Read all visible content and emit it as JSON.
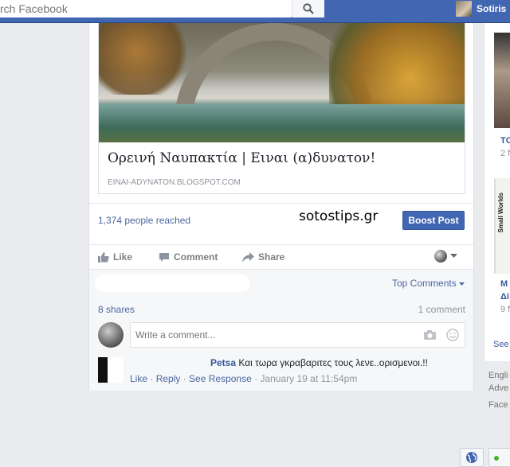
{
  "header": {
    "search_placeholder": "rch Facebook",
    "user_name": "Sotiris"
  },
  "post": {
    "link_title": "Ορεινή Ναυπακτία | Ειναι (α)δυνατον!",
    "link_domain": "EINAI-ADYNATON.BLOGSPOT.COM",
    "reach": "1,374 people reached",
    "watermark": "sotostips.gr",
    "boost_label": "Boost Post",
    "actions": {
      "like": "Like",
      "comment": "Comment",
      "share": "Share"
    },
    "top_comments": "Top Comments",
    "shares": "8 shares",
    "comment_count": "1 comment",
    "compose_placeholder": "Write a comment...",
    "comment": {
      "author": "Petsa",
      "text": "Και τωρα γκραβαριτες τους λενε..ορισμενοι.!!",
      "like": "Like",
      "reply": "Reply",
      "see_response": "See Response",
      "time": "January 19 at 11:54pm"
    }
  },
  "right": {
    "item1_title": "TC",
    "item1_sub": "2 f",
    "item2_book": "Small Worlds",
    "item2_title": "Μ",
    "item2_title2": "Δί",
    "item2_sub": "9 f",
    "see": "See",
    "footer1": "Engli",
    "footer2": "Adve",
    "footer3": "Face"
  },
  "colors": {
    "brand": "#4267b2",
    "link": "#4b67a1",
    "online": "#42b72a"
  }
}
